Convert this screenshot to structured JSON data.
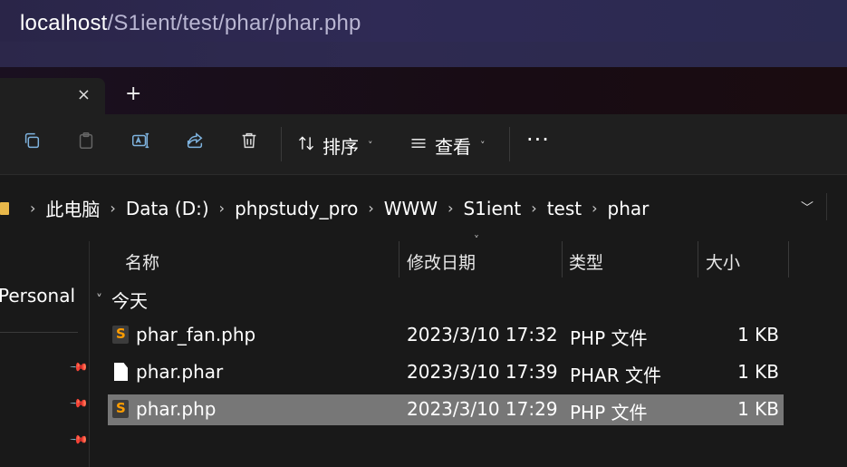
{
  "browser": {
    "url_host": "localhost",
    "url_path": "/S1ient/test/phar/phar.php"
  },
  "tabs": {
    "close_icon": "×",
    "new_tab_icon": "+"
  },
  "toolbar": {
    "sort_label": "排序",
    "view_label": "查看",
    "more_label": "···",
    "icons": [
      "copy-icon",
      "paste-icon",
      "rename-icon",
      "share-icon",
      "delete-icon",
      "sort-icon",
      "view-icon"
    ]
  },
  "breadcrumb": {
    "items": [
      "此电脑",
      "Data (D:)",
      "phpstudy_pro",
      "WWW",
      "S1ient",
      "test",
      "phar"
    ]
  },
  "sidebar": {
    "personal_label": "Personal"
  },
  "columns": {
    "name": "名称",
    "date": "修改日期",
    "type": "类型",
    "size": "大小"
  },
  "group_label": "今天",
  "files": [
    {
      "name": "phar_fan.php",
      "date": "2023/3/10 17:32",
      "type": "PHP 文件",
      "size": "1 KB",
      "icon": "php-file-icon",
      "selected": false
    },
    {
      "name": "phar.phar",
      "date": "2023/3/10 17:39",
      "type": "PHAR 文件",
      "size": "1 KB",
      "icon": "generic-file-icon",
      "selected": false
    },
    {
      "name": "phar.php",
      "date": "2023/3/10 17:29",
      "type": "PHP 文件",
      "size": "1 KB",
      "icon": "php-file-icon",
      "selected": true
    }
  ],
  "colors": {
    "selection": "#777777",
    "folder": "#e8b84a",
    "php_icon_accent": "#ff9d00"
  }
}
